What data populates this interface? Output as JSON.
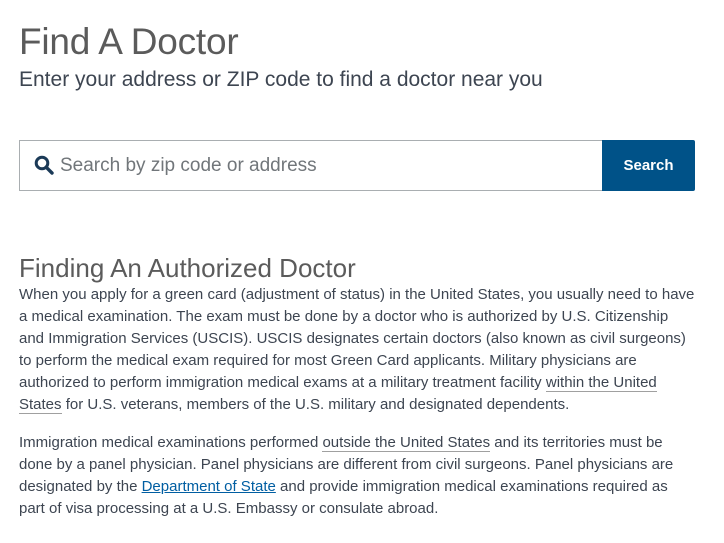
{
  "header": {
    "title": "Find A Doctor",
    "subtitle": "Enter your address or ZIP code to find a doctor near you"
  },
  "search": {
    "placeholder": "Search by zip code or address",
    "value": "",
    "button_label": "Search",
    "icon": "search-icon"
  },
  "section": {
    "title": "Finding An Authorized Doctor",
    "paragraph1": {
      "text_before": "When you apply for a green card (adjustment of status) in the United States, you usually need to have a medical examination. The exam must be done by a doctor who is authorized by U.S. Citizenship and Immigration Services (USCIS). USCIS designates certain doctors (also known as civil surgeons) to perform the medical exam required for most Green Card applicants. Military physicians are authorized to perform immigration medical exams at a military treatment facility ",
      "highlight": "within the United States",
      "text_after": " for U.S. veterans, members of the U.S. military and designated dependents."
    },
    "paragraph2": {
      "text_before": "Immigration medical examinations performed ",
      "highlight": "outside the United States",
      "text_middle": " and its territories must be done by a panel physician. Panel physicians are different from civil surgeons. Panel physicians are designated by the ",
      "link_label": "Department of State",
      "text_after": " and provide immigration medical examinations required as part of visa processing at a U.S. Embassy or consulate abroad."
    }
  },
  "colors": {
    "primary_button": "#005288",
    "link": "#005ea2",
    "text": "#3d4551",
    "heading": "#5b5b5b"
  }
}
